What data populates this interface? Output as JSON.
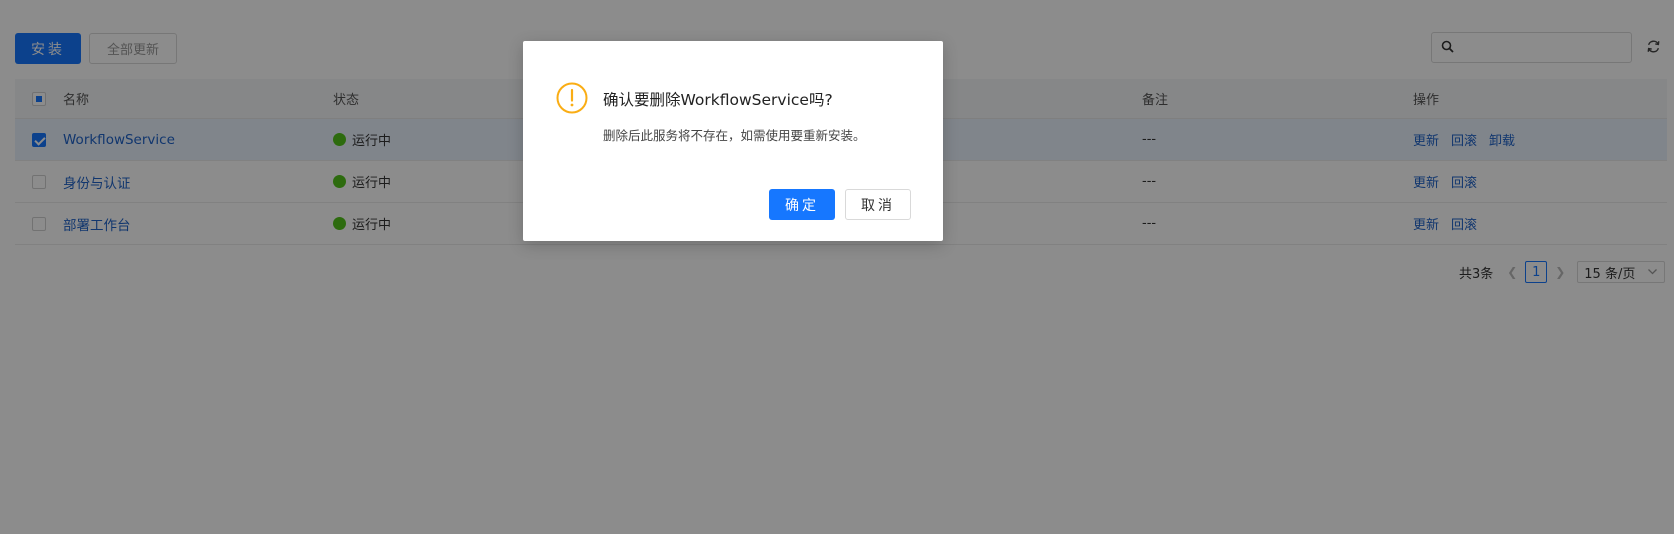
{
  "toolbar": {
    "install_label": "安装",
    "update_all_label": "全部更新",
    "search_placeholder": ""
  },
  "table": {
    "columns": {
      "name": "名称",
      "status": "状态",
      "remark": "备注",
      "ops": "操作"
    },
    "rows": [
      {
        "name": "WorkflowService",
        "status": "运行中",
        "remark": "---",
        "ops": [
          "更新",
          "回滚",
          "卸载"
        ],
        "selected": true
      },
      {
        "name": "身份与认证",
        "status": "运行中",
        "remark": "---",
        "ops": [
          "更新",
          "回滚"
        ],
        "selected": false
      },
      {
        "name": "部署工作台",
        "status": "运行中",
        "remark": "---",
        "ops": [
          "更新",
          "回滚"
        ],
        "selected": false
      }
    ]
  },
  "pagination": {
    "total": "共3条",
    "current_page": "1",
    "page_size": "15 条/页"
  },
  "dialog": {
    "title": "确认要删除WorkflowService吗?",
    "content": "删除后此服务将不存在，如需使用要重新安装。",
    "ok_label": "确定",
    "cancel_label": "取消"
  },
  "colors": {
    "primary": "#1677ff",
    "link": "#1f63c9",
    "status_running": "#52c41a",
    "warning": "#faad14"
  },
  "icons": {
    "search": "search-icon",
    "refresh": "refresh-icon",
    "warning": "warning-icon"
  }
}
